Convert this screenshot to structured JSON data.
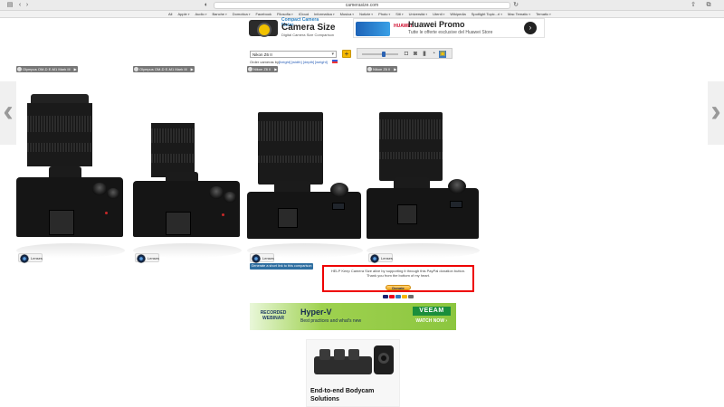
{
  "browser": {
    "url": "camerasize.com",
    "reader_icon": "reader-icon",
    "bookmarks": [
      {
        "label": "All"
      },
      {
        "label": "Apple"
      },
      {
        "label": "Audio"
      },
      {
        "label": "Banche"
      },
      {
        "label": "Domotica"
      },
      {
        "label": "Facebook"
      },
      {
        "label": "Filosofia"
      },
      {
        "label": "iCloud"
      },
      {
        "label": "Informatica"
      },
      {
        "label": "Musica"
      },
      {
        "label": "Notizie"
      },
      {
        "label": "Photo"
      },
      {
        "label": "Siti"
      },
      {
        "label": "Università"
      },
      {
        "label": "Utenti"
      },
      {
        "label": "Wikipedia"
      },
      {
        "label": "Spotlight Topic...ri"
      },
      {
        "label": "Mac Tematic"
      },
      {
        "label": "Tematic"
      }
    ]
  },
  "header": {
    "logo_tagline": "Compact Camera Meter",
    "logo_title": "Camera Size",
    "logo_subtitle": "Digital Camera Size Comparison",
    "promo_brand": "HUAWEI",
    "promo_title": "Huawei Promo",
    "promo_subtitle": "Tutte le offerte esclusive del Huawei Store",
    "promo_go": "›"
  },
  "controls": {
    "selected_camera": "Nikon Z6 II",
    "add_label": "+",
    "order_label": "Order cameras by:",
    "order_links": [
      "[height]",
      "[width]",
      "[depth]",
      "[weight]"
    ],
    "zoom_level": 0.6
  },
  "cameras": [
    {
      "name": "Olympus OM-D E-M1 Mark III"
    },
    {
      "name": "Olympus OM-D E-M1 Mark III"
    },
    {
      "name": "Nikon Z6 II"
    },
    {
      "name": "Nikon Z6 II"
    }
  ],
  "lens_label": "Lenses",
  "nav": {
    "prev": "‹",
    "next": "›"
  },
  "bottom": {
    "short_link": "Generate a short link to this comparison",
    "donate_line1": "HELP Keep Camera Size alive by supporting it through this PayPal donation button.",
    "donate_line2": "Thank you from the bottom of my heart.",
    "donate_button": "Donate",
    "card_colors": [
      "#1a1f71",
      "#eb001b",
      "#2e77bc",
      "#f7b600",
      "#6c6c6c"
    ]
  },
  "ads": {
    "banner_recorded": "RECORDED",
    "banner_webinar": "WEBINAR",
    "banner_title": "Hyper-V",
    "banner_subtitle": "Best practices and what's new",
    "banner_logo": "VEEAM",
    "banner_cta": "WATCH NOW ›",
    "ad2_line1": "End-to-end Bodycam",
    "ad2_line2": "Solutions"
  }
}
